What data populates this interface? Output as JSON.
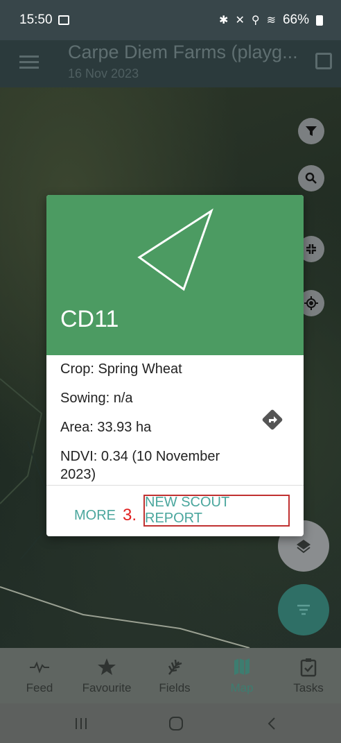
{
  "status_bar": {
    "time": "15:50",
    "indicators": "✱ ✕ ⚲ ≋ ▮ ",
    "battery": "66%"
  },
  "header": {
    "title": "Carpe Diem Farms (playg...",
    "date": "16 Nov 2023"
  },
  "card": {
    "field_name": "CD11",
    "crop": "Crop: Spring Wheat",
    "sowing": "Sowing: n/a",
    "area": "Area: 33.93 ha",
    "ndvi": "NDVI: 0.34 (10 November 2023)",
    "more_label": "MORE",
    "annotation": "3.",
    "scout_label": "NEW SCOUT REPORT"
  },
  "bottom_nav": [
    {
      "label": "Feed"
    },
    {
      "label": "Favourite"
    },
    {
      "label": "Fields"
    },
    {
      "label": "Map"
    },
    {
      "label": "Tasks"
    }
  ],
  "colors": {
    "accent": "#4aa69d",
    "card_green": "#4c9b62",
    "annotation_red": "#c03030"
  }
}
